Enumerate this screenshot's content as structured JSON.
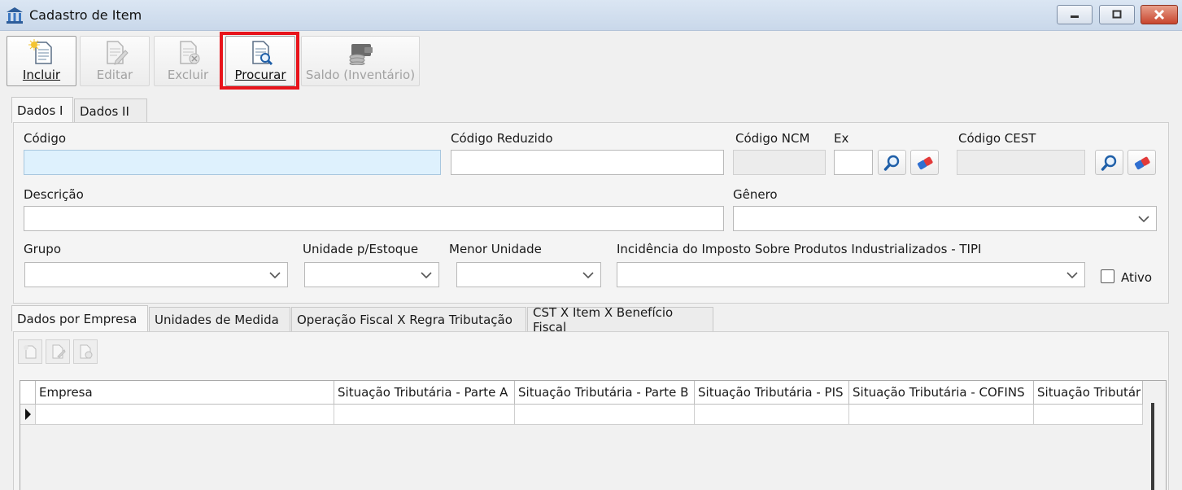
{
  "window": {
    "title": "Cadastro de Item"
  },
  "toolbar": {
    "incluir": "Incluir",
    "editar": "Editar",
    "excluir": "Excluir",
    "procurar": "Procurar",
    "saldo": "Saldo (Inventário)"
  },
  "tabs_top": [
    "Dados I",
    "Dados II"
  ],
  "form": {
    "codigo_label": "Código",
    "codigo_reduzido_label": "Código Reduzido",
    "codigo_ncm_label": "Código NCM",
    "ex_label": "Ex",
    "codigo_cest_label": "Código CEST",
    "descricao_label": "Descrição",
    "genero_label": "Gênero",
    "grupo_label": "Grupo",
    "unidade_estoque_label": "Unidade p/Estoque",
    "menor_unidade_label": "Menor Unidade",
    "tipi_label": "Incidência do Imposto Sobre Produtos Industrializados - TIPI",
    "ativo_label": "Ativo"
  },
  "tabs_bottom": [
    "Dados por Empresa",
    "Unidades de Medida",
    "Operação Fiscal X Regra Tributação",
    "CST X Item X Benefício Fiscal"
  ],
  "grid": {
    "columns": [
      "Empresa",
      "Situação Tributária - Parte A",
      "Situação Tributária - Parte B",
      "Situação Tributária - PIS",
      "Situação Tributária - COFINS",
      "Situação Tributár"
    ]
  },
  "icons": {
    "app": "building-icon",
    "search": "magnifier-icon",
    "clear": "eraser-icon"
  },
  "colors": {
    "highlight": "#e8141b",
    "focus_field": "#def1fd"
  }
}
